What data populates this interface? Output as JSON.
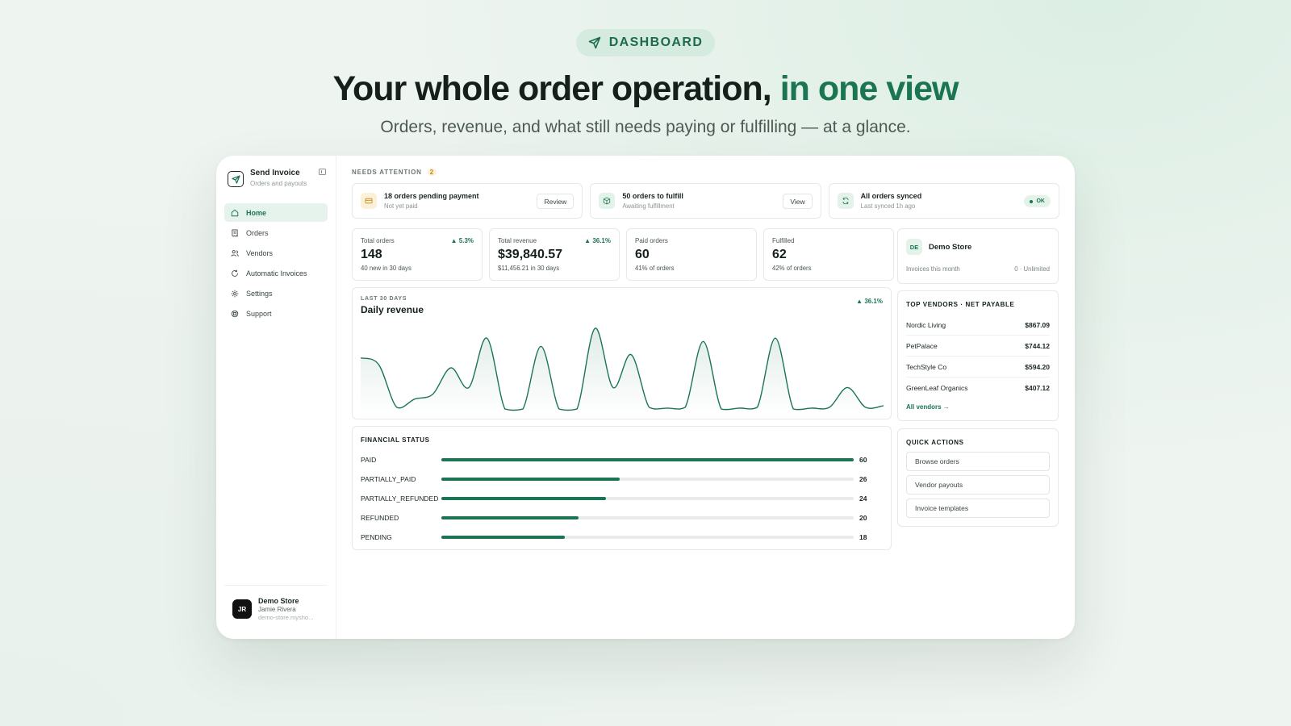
{
  "hero": {
    "pill_label": "DASHBOARD",
    "headline_main": "Your whole order operation,",
    "headline_accent": "in one view",
    "subheadline": "Orders, revenue, and what still needs paying or fulfilling — at a glance."
  },
  "sidebar": {
    "brand_name": "Send Invoice",
    "brand_sub": "Orders and payouts",
    "items": [
      {
        "label": "Home",
        "icon": "home-icon",
        "active": true
      },
      {
        "label": "Orders",
        "icon": "receipt-icon"
      },
      {
        "label": "Vendors",
        "icon": "users-icon"
      },
      {
        "label": "Automatic Invoices",
        "icon": "refresh-icon"
      },
      {
        "label": "Settings",
        "icon": "gear-icon"
      },
      {
        "label": "Support",
        "icon": "lifebuoy-icon"
      }
    ],
    "account": {
      "initials": "JR",
      "store": "Demo Store",
      "user": "Jamie Rivera",
      "domain": "demo-store.myshо..."
    }
  },
  "attention": {
    "label": "NEEDS ATTENTION",
    "count": "2",
    "cards": [
      {
        "title": "18 orders pending payment",
        "sub": "Not yet paid",
        "action": "Review",
        "icon": "card-icon",
        "color": "#fbf0d8"
      },
      {
        "title": "50 orders to fulfill",
        "sub": "Awaiting fulfillment",
        "action": "View",
        "icon": "box-icon",
        "color": "#e3f3ea"
      },
      {
        "title": "All orders synced",
        "sub": "Last synced 1h ago",
        "status": "OK",
        "icon": "sync-icon",
        "color": "#e3f3ea"
      }
    ]
  },
  "stats": [
    {
      "label": "Total orders",
      "value": "148",
      "foot": "40 new in 30 days",
      "delta": "▲ 5.3%"
    },
    {
      "label": "Total revenue",
      "value": "$39,840.57",
      "foot": "$11,456.21 in 30 days",
      "delta": "▲ 36.1%"
    },
    {
      "label": "Paid orders",
      "value": "60",
      "foot": "41% of orders"
    },
    {
      "label": "Fulfilled",
      "value": "62",
      "foot": "42% of orders"
    }
  ],
  "store": {
    "initials": "DE",
    "name": "Demo Store",
    "invoices_label": "Invoices this month",
    "invoices_value": "0 · Unlimited"
  },
  "revenue_chart": {
    "kicker": "LAST 30 DAYS",
    "title": "Daily revenue",
    "delta": "▲ 36.1%"
  },
  "chart_data": {
    "type": "area",
    "title": "Daily revenue",
    "x": [
      1,
      2,
      3,
      4,
      5,
      6,
      7,
      8,
      9,
      10,
      11,
      12,
      13,
      14,
      15,
      16,
      17,
      18,
      19,
      20,
      21,
      22,
      23,
      24,
      25,
      26,
      27,
      28,
      29,
      30
    ],
    "values": [
      640,
      560,
      40,
      140,
      200,
      520,
      280,
      880,
      20,
      20,
      780,
      20,
      20,
      1000,
      280,
      680,
      40,
      30,
      40,
      840,
      20,
      30,
      40,
      880,
      20,
      30,
      40,
      280,
      40,
      60
    ],
    "ylim": [
      0,
      1000
    ],
    "grid": false
  },
  "vendors": {
    "heading": "TOP VENDORS · NET PAYABLE",
    "rows": [
      {
        "name": "Nordic Living",
        "amount": "$867.09"
      },
      {
        "name": "PetPalace",
        "amount": "$744.12"
      },
      {
        "name": "TechStyle Co",
        "amount": "$594.20"
      },
      {
        "name": "GreenLeaf Organics",
        "amount": "$407.12"
      }
    ],
    "link": "All vendors →"
  },
  "financial": {
    "heading": "FINANCIAL STATUS",
    "max": 60,
    "rows": [
      {
        "label": "PAID",
        "value": 60
      },
      {
        "label": "PARTIALLY_PAID",
        "value": 26
      },
      {
        "label": "PARTIALLY_REFUNDED",
        "value": 24
      },
      {
        "label": "REFUNDED",
        "value": 20
      },
      {
        "label": "PENDING",
        "value": 18
      }
    ]
  },
  "quick_actions": {
    "heading": "QUICK ACTIONS",
    "items": [
      "Browse orders",
      "Vendor payouts",
      "Invoice templates"
    ]
  },
  "colors": {
    "accent": "#1b7553",
    "warning": "#c88a12"
  }
}
